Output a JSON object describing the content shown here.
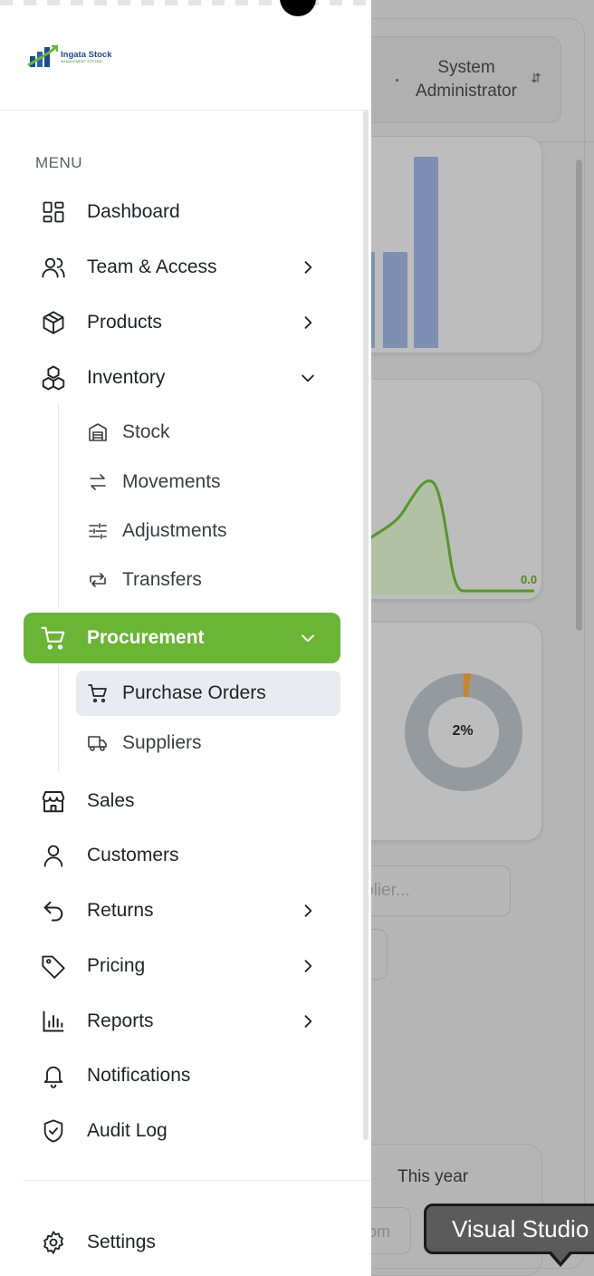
{
  "background": {
    "user": {
      "name": "System Administrator"
    },
    "line_chart": {
      "value_label": "0.0"
    },
    "donut": {
      "percent_label": "2%",
      "percent": 2
    },
    "search": {
      "placeholder_fragment": "plier..."
    },
    "period": {
      "label": "This year"
    },
    "button_fragment": "om",
    "bars": [
      0.4,
      0.4,
      0.8
    ]
  },
  "tooltip": {
    "text": "Visual Studio"
  },
  "logo": {
    "name": "Ingata Stock",
    "tagline": "MANAGEMENT SYSTEM"
  },
  "sidebar": {
    "menu_label": "MENU",
    "items": [
      {
        "label": "Dashboard",
        "icon": "dashboard-icon"
      },
      {
        "label": "Team & Access",
        "icon": "users-icon"
      },
      {
        "label": "Products",
        "icon": "box-icon"
      },
      {
        "label": "Inventory",
        "icon": "boxes-icon"
      },
      {
        "label": "Procurement",
        "icon": "cart-icon"
      },
      {
        "label": "Sales",
        "icon": "store-icon"
      },
      {
        "label": "Customers",
        "icon": "user-icon"
      },
      {
        "label": "Returns",
        "icon": "undo-icon"
      },
      {
        "label": "Pricing",
        "icon": "tag-icon"
      },
      {
        "label": "Reports",
        "icon": "bar-chart-icon"
      },
      {
        "label": "Notifications",
        "icon": "bell-icon"
      },
      {
        "label": "Audit Log",
        "icon": "shield-check-icon"
      },
      {
        "label": "Settings",
        "icon": "gear-icon"
      }
    ],
    "inventory_sub": [
      {
        "label": "Stock",
        "icon": "warehouse-icon"
      },
      {
        "label": "Movements",
        "icon": "arrows-swap-icon"
      },
      {
        "label": "Adjustments",
        "icon": "sliders-icon"
      },
      {
        "label": "Transfers",
        "icon": "repeat-icon"
      }
    ],
    "procurement_sub": [
      {
        "label": "Purchase Orders",
        "icon": "cart-icon"
      },
      {
        "label": "Suppliers",
        "icon": "truck-icon"
      }
    ],
    "active_item": "Procurement",
    "selected_sub": "Purchase Orders",
    "accent_color": "#6ab536"
  }
}
